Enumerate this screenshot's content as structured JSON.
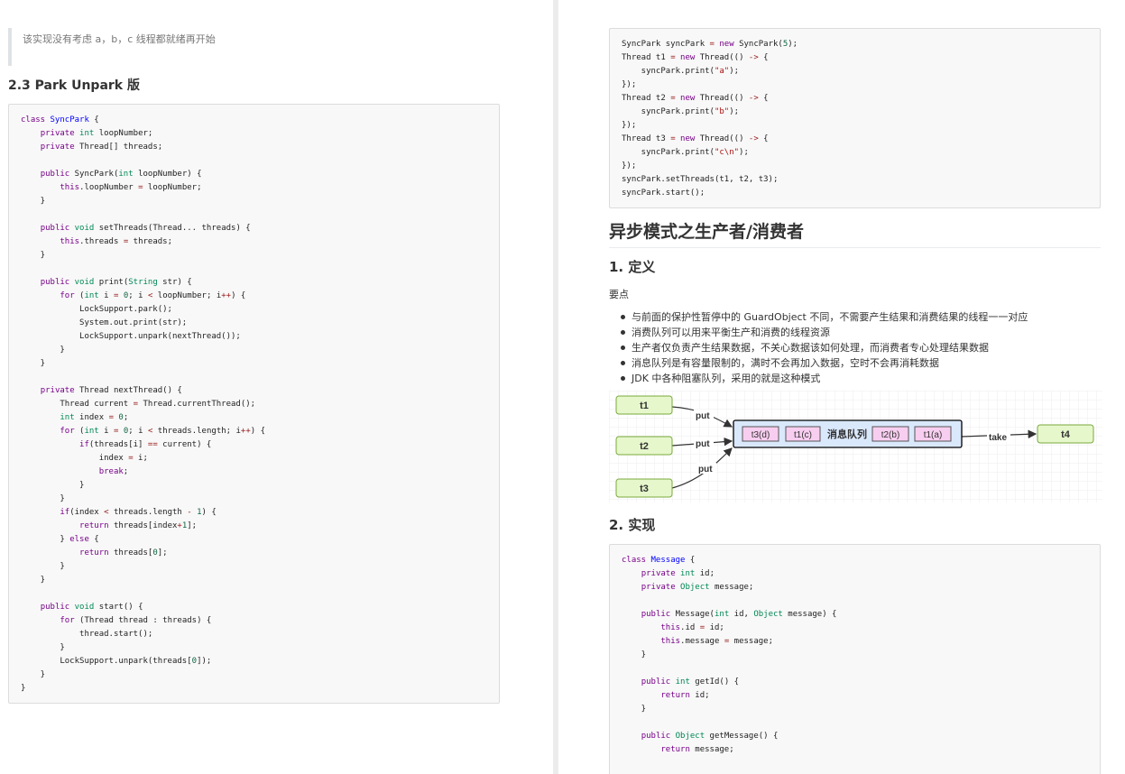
{
  "left_page": {
    "quote": "该实现没有考虑 a，b，c 线程都就绪再开始",
    "section_heading": "2.3 Park Unpark 版"
  },
  "right_page": {
    "heading_main": "异步模式之生产者/消费者",
    "heading_definition": "1. 定义",
    "key_points_label": "要点",
    "bullets": [
      "与前面的保护性暂停中的 GuardObject 不同，不需要产生结果和消费结果的线程一一对应",
      "消费队列可以用来平衡生产和消费的线程资源",
      "生产者仅负责产生结果数据，不关心数据该如何处理，而消费者专心处理结果数据",
      "消息队列是有容量限制的，满时不会再加入数据，空时不会再消耗数据",
      "JDK 中各种阻塞队列，采用的就是这种模式"
    ],
    "heading_implementation": "2. 实现"
  },
  "diagram": {
    "producers": [
      "t1",
      "t2",
      "t3"
    ],
    "consumer": "t4",
    "queue_label": "消息队列",
    "queue_items": [
      "t3(d)",
      "t1(c)",
      "t2(b)",
      "t1(a)"
    ],
    "put_label": "put",
    "take_label": "take",
    "colors": {
      "thread_fill": "#e6f7cc",
      "thread_border": "#7aaa3c",
      "queue_fill": "#dae8fc",
      "queue_border": "#000000",
      "item_fill": "#f8cef0",
      "grid": "#eeeeee"
    }
  },
  "code_colors": {
    "keyword": "#770088",
    "type": "#008855",
    "definition": "#0000ff",
    "string": "#aa1111",
    "number": "#116644",
    "operator": "#981a1a"
  }
}
